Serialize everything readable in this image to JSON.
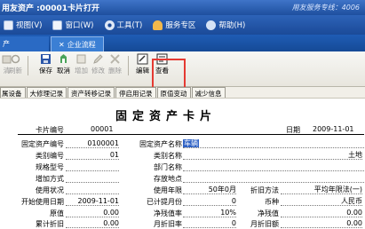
{
  "title": "用友资产 :00001卡片打开",
  "title_hint": "用友服务专线：4006",
  "menu": [
    {
      "label": "视图(V)",
      "icon": "view-icon",
      "color": "#e9eef8"
    },
    {
      "label": "窗口(W)",
      "icon": "window-icon",
      "color": "#f0f4fb"
    },
    {
      "label": "工具(T)",
      "icon": "gear-icon",
      "color": "#dfe8f6"
    },
    {
      "label": "服务专区",
      "icon": "service-icon",
      "color": "#f2b84b"
    },
    {
      "label": "帮助(H)",
      "icon": "help-icon",
      "color": "#d5e2f5"
    }
  ],
  "tabs": {
    "left": "产",
    "active": "企业流程"
  },
  "toolbar": {
    "clear_disabled": "清",
    "refresh": "刷新",
    "save": "保存",
    "cancel": "取消",
    "add": "增加",
    "modify": "修改",
    "delete": "删除",
    "edit": "编辑",
    "view": "查看"
  },
  "subtabs": [
    "属设备",
    "大修理记录",
    "资产转移记录",
    "停启用记录",
    "原值变动",
    "减少信息"
  ],
  "card": {
    "title": "固定资产卡片",
    "card_no_label": "卡片编号",
    "card_no": "00001",
    "date_label": "日期",
    "date": "2009-11-01",
    "fields": [
      {
        "label": "固定资产编号",
        "value": "0100001"
      },
      {
        "label": "固定资产名称",
        "value": "车辆"
      },
      {
        "label": "类别编号",
        "value": "01"
      },
      {
        "label": "类别名称",
        "value": "土地"
      },
      {
        "label": "规格型号",
        "value": ""
      },
      {
        "label": "部门名称",
        "value": ""
      },
      {
        "label": "增加方式",
        "value": ""
      },
      {
        "label": "存放地点",
        "value": ""
      },
      {
        "label": "使用状况",
        "value": ""
      },
      {
        "label": "使用年限",
        "value": "50年0月"
      },
      {
        "label": "折旧方法",
        "value": "平均年限法(一)"
      },
      {
        "label": "开始使用日期",
        "value": "2009-11-01"
      },
      {
        "label": "已计提月份",
        "value": "0"
      },
      {
        "label": "币种",
        "value": "人民币"
      },
      {
        "label": "原值",
        "value": "0.00"
      },
      {
        "label": "净残值率",
        "value": "10%"
      },
      {
        "label": "净残值",
        "value": "0.00"
      },
      {
        "label": "累计折旧",
        "value": "0.00"
      },
      {
        "label": "月折旧率",
        "value": "0"
      },
      {
        "label": "月折旧额",
        "value": "0.00"
      }
    ]
  }
}
